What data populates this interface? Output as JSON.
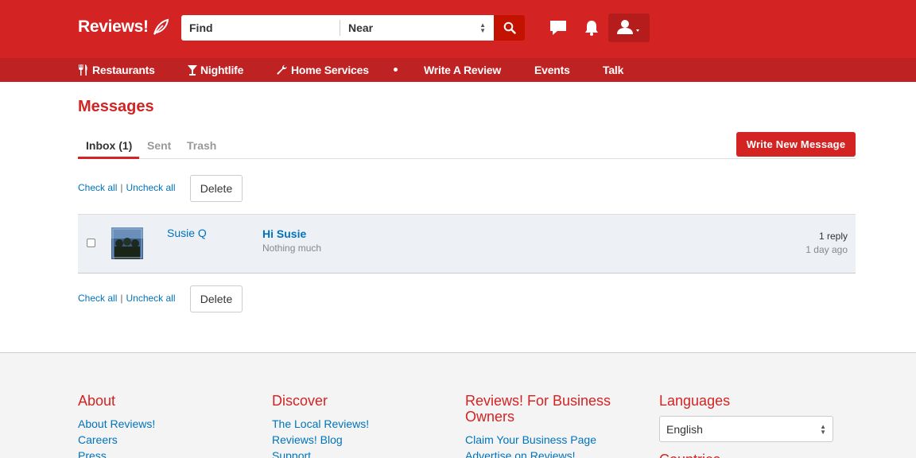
{
  "header": {
    "logo_text": "Reviews!",
    "find_placeholder": "Find",
    "near_placeholder": "Near"
  },
  "nav": {
    "items": [
      {
        "label": "Restaurants",
        "icon": "fork-knife-icon"
      },
      {
        "label": "Nightlife",
        "icon": "cocktail-icon"
      },
      {
        "label": "Home Services",
        "icon": "wrench-icon"
      },
      {
        "label": "Write A Review"
      },
      {
        "label": "Events"
      },
      {
        "label": "Talk"
      }
    ]
  },
  "main": {
    "title": "Messages",
    "tabs": [
      {
        "label": "Inbox (1)",
        "active": true
      },
      {
        "label": "Sent",
        "active": false
      },
      {
        "label": "Trash",
        "active": false
      }
    ],
    "write_button": "Write New Message",
    "check_all": "Check all",
    "separator": "|",
    "uncheck_all": "Uncheck all",
    "delete": "Delete",
    "messages": [
      {
        "sender": "Susie Q",
        "subject": "Hi Susie",
        "preview": "Nothing much",
        "replies": "1 reply",
        "time": "1 day ago"
      }
    ]
  },
  "footer": {
    "about": {
      "title": "About",
      "links": [
        "About Reviews!",
        "Careers",
        "Press"
      ]
    },
    "discover": {
      "title": "Discover",
      "links": [
        "The Local Reviews!",
        "Reviews! Blog",
        "Support"
      ]
    },
    "business": {
      "title": "Reviews! For Business Owners",
      "links": [
        "Claim Your Business Page",
        "Advertise on Reviews!"
      ]
    },
    "languages": {
      "title": "Languages",
      "selected": "English",
      "countries_title": "Countries"
    }
  },
  "colors": {
    "brand_red": "#d32323",
    "nav_red": "#be2222",
    "link_blue": "#0073bb"
  }
}
